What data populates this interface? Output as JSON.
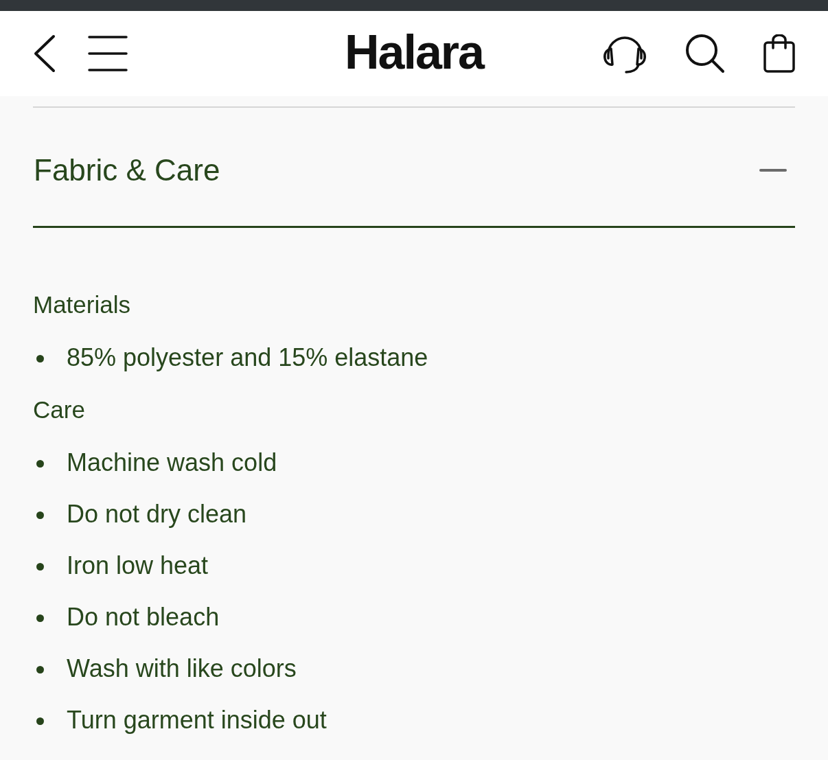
{
  "header": {
    "logo": "Halara"
  },
  "section": {
    "title": "Fabric & Care",
    "expanded": true
  },
  "groups": [
    {
      "heading": "Materials",
      "items": [
        "85% polyester and 15% elastane"
      ]
    },
    {
      "heading": "Care",
      "items": [
        "Machine wash cold",
        "Do not dry clean",
        "Iron low heat",
        "Do not bleach",
        "Wash with like colors",
        "Turn garment inside out"
      ]
    }
  ]
}
